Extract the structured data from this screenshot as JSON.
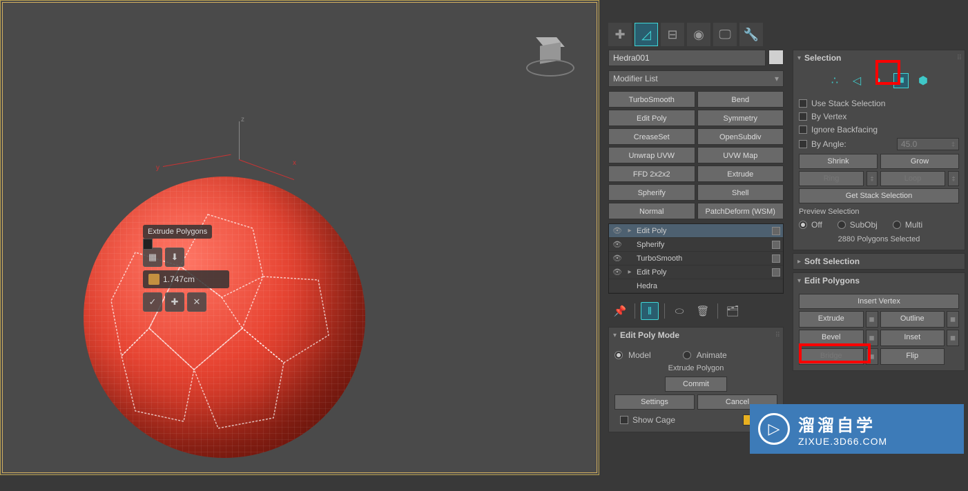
{
  "viewport": {
    "axis_x": "x",
    "axis_y": "y",
    "axis_z": "z"
  },
  "caddy": {
    "title": "Extrude Polygons",
    "value": "1.747cm"
  },
  "object": {
    "name": "Hedra001"
  },
  "modifier_dropdown": "Modifier List",
  "modifiers": [
    "TurboSmooth",
    "Bend",
    "Edit Poly",
    "Symmetry",
    "CreaseSet",
    "OpenSubdiv",
    "Unwrap UVW",
    "UVW Map",
    "FFD 2x2x2",
    "Extrude",
    "Spherify",
    "Shell",
    "Normal",
    "PatchDeform (WSM)"
  ],
  "stack": [
    {
      "label": "Edit Poly",
      "eye": true,
      "arrow": true,
      "selected": true
    },
    {
      "label": "Spherify",
      "eye": true,
      "arrow": false,
      "selected": false
    },
    {
      "label": "TurboSmooth",
      "eye": true,
      "arrow": false,
      "selected": false
    },
    {
      "label": "Edit Poly",
      "eye": true,
      "arrow": true,
      "selected": false
    },
    {
      "label": "Hedra",
      "eye": false,
      "arrow": false,
      "selected": false
    }
  ],
  "edit_poly_mode": {
    "title": "Edit Poly Mode",
    "model": "Model",
    "animate": "Animate",
    "current": "Extrude Polygon",
    "commit": "Commit",
    "settings": "Settings",
    "cancel": "Cancel",
    "show_cage": "Show Cage"
  },
  "selection": {
    "title": "Selection",
    "use_stack": "Use Stack Selection",
    "by_vertex": "By Vertex",
    "ignore_backfacing": "Ignore Backfacing",
    "by_angle": "By Angle:",
    "by_angle_value": "45.0",
    "shrink": "Shrink",
    "grow": "Grow",
    "ring": "Ring",
    "loop": "Loop",
    "get_stack": "Get Stack Selection",
    "preview": "Preview Selection",
    "off": "Off",
    "subobj": "SubObj",
    "multi": "Multi",
    "status": "2880 Polygons Selected"
  },
  "soft_selection": {
    "title": "Soft Selection"
  },
  "edit_polygons": {
    "title": "Edit Polygons",
    "insert_vertex": "Insert Vertex",
    "extrude": "Extrude",
    "outline": "Outline",
    "bevel": "Bevel",
    "inset": "Inset",
    "bridge": "Bridge",
    "flip": "Flip"
  },
  "watermark": {
    "cn": "溜溜自学",
    "url": "ZIXUE.3D66.COM"
  }
}
